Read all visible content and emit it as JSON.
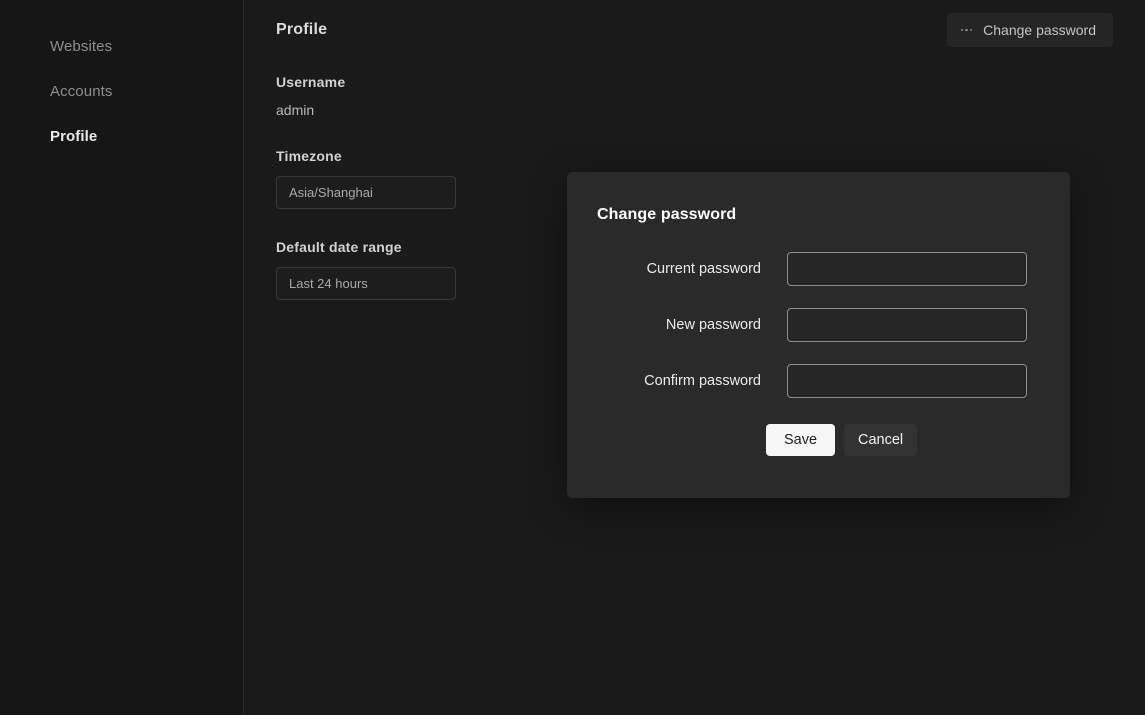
{
  "sidebar": {
    "items": [
      {
        "label": "Websites",
        "name": "sidebar-item-websites",
        "active": false
      },
      {
        "label": "Accounts",
        "name": "sidebar-item-accounts",
        "active": false
      },
      {
        "label": "Profile",
        "name": "sidebar-item-profile",
        "active": true
      }
    ]
  },
  "header": {
    "title": "Profile",
    "change_password_label": "Change password",
    "change_password_icon": "ellipsis-icon"
  },
  "profile": {
    "username_label": "Username",
    "username_value": "admin",
    "timezone_label": "Timezone",
    "timezone_value": "Asia/Shanghai",
    "date_range_label": "Default date range",
    "date_range_value": "Last 24 hours"
  },
  "modal": {
    "title": "Change password",
    "fields": [
      {
        "label": "Current password",
        "value": "",
        "placeholder": ""
      },
      {
        "label": "New password",
        "value": "",
        "placeholder": ""
      },
      {
        "label": "Confirm password",
        "value": "",
        "placeholder": ""
      }
    ],
    "save_label": "Save",
    "cancel_label": "Cancel"
  },
  "colors": {
    "app_background": "#1a1a1a",
    "sidebar_background": "#161616",
    "modal_background": "#2a2a2a",
    "primary_button": "#f7f7f7",
    "secondary_button": "#333333",
    "input_border": "#8d8d8d",
    "divider": "#2b2b2b"
  }
}
